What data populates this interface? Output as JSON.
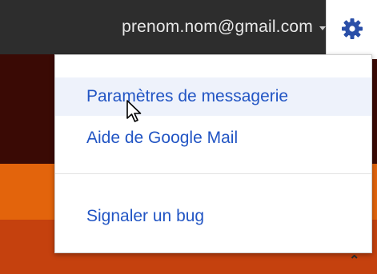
{
  "header": {
    "account_email": "prenom.nom@gmail.com",
    "account_caret_icon": "caret-down-icon",
    "settings_icon": "gear-icon"
  },
  "menu": {
    "items": [
      {
        "label": "Paramètres de messagerie"
      },
      {
        "label": "Aide de Google Mail"
      },
      {
        "label": "Signaler un bug"
      }
    ],
    "hovered_index": 0
  },
  "colors": {
    "topbar": "#2d2d2d",
    "link": "#2255c4",
    "hover": "#eef2fb",
    "gear": "#2a4fa8"
  },
  "scroll_icon": "chevron-up-icon",
  "mouse_cursor_icon": "pointer-arrow-icon"
}
